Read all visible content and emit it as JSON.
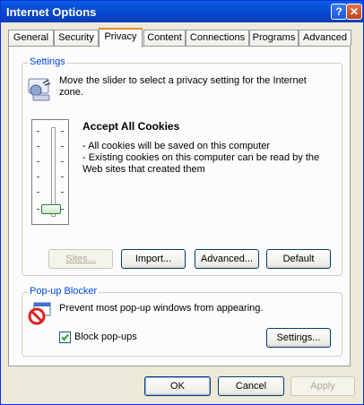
{
  "window": {
    "title": "Internet Options",
    "help_glyph": "?",
    "close_glyph": "✕"
  },
  "tabs": [
    {
      "label": "General"
    },
    {
      "label": "Security"
    },
    {
      "label": "Privacy",
      "active": true
    },
    {
      "label": "Content"
    },
    {
      "label": "Connections"
    },
    {
      "label": "Programs"
    },
    {
      "label": "Advanced"
    }
  ],
  "settings": {
    "legend": "Settings",
    "instruction": "Move the slider to select a privacy setting for the Internet zone.",
    "level_title": "Accept All Cookies",
    "level_desc_1": "- All cookies will be saved on this computer",
    "level_desc_2": "- Existing cookies on this computer can be read by the Web sites that created them",
    "slider_level": 0,
    "buttons": {
      "sites": "Sites...",
      "import": "Import...",
      "advanced": "Advanced...",
      "default": "Default"
    }
  },
  "popup": {
    "legend": "Pop-up Blocker",
    "description": "Prevent most pop-up windows from appearing.",
    "checkbox_label": "Block pop-ups",
    "checkbox_checked": true,
    "settings_button": "Settings..."
  },
  "footer": {
    "ok": "OK",
    "cancel": "Cancel",
    "apply": "Apply"
  },
  "colors": {
    "accent": "#0046d5",
    "titlebar": "#0a5ee8"
  }
}
